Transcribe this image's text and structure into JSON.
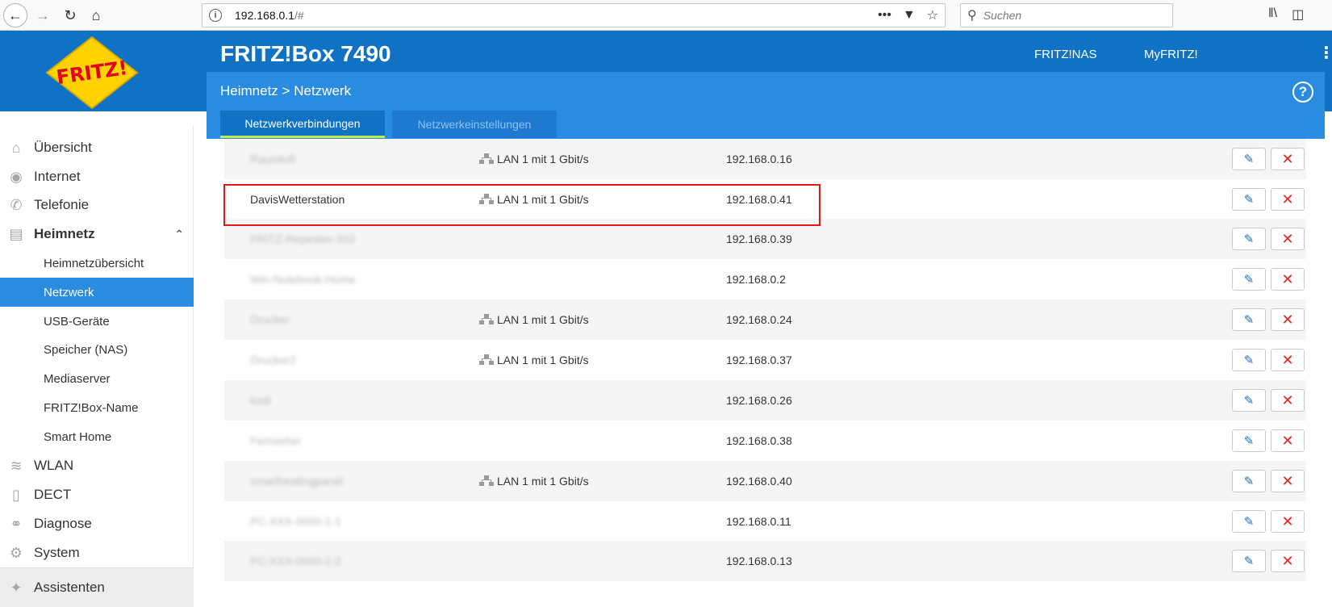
{
  "browser": {
    "url_host": "192.168.0.1",
    "url_rest": "/#",
    "search_placeholder": "Suchen",
    "more_glyph": "•••"
  },
  "header": {
    "logo_text": "FRITZ!",
    "title": "FRITZ!Box 7490",
    "links": [
      "FRITZ!NAS",
      "MyFRITZ!"
    ]
  },
  "breadcrumb": {
    "section": "Heimnetz",
    "separator": ">",
    "page": "Netzwerk"
  },
  "help_glyph": "?",
  "tabs": [
    {
      "label": "Netzwerkverbindungen",
      "active": true
    },
    {
      "label": "Netzwerkeinstellungen",
      "active": false
    }
  ],
  "sidebar": {
    "items": [
      {
        "label": "Übersicht",
        "icon": "home-icon"
      },
      {
        "label": "Internet",
        "icon": "globe-icon"
      },
      {
        "label": "Telefonie",
        "icon": "phone-icon"
      },
      {
        "label": "Heimnetz",
        "icon": "network-icon",
        "expanded": true
      },
      {
        "label": "WLAN",
        "icon": "wifi-icon"
      },
      {
        "label": "DECT",
        "icon": "dect-icon"
      },
      {
        "label": "Diagnose",
        "icon": "diagnose-icon"
      },
      {
        "label": "System",
        "icon": "system-icon"
      },
      {
        "label": "Assistenten",
        "icon": "wizard-icon"
      }
    ],
    "subitems": [
      {
        "label": "Heimnetzübersicht"
      },
      {
        "label": "Netzwerk",
        "active": true
      },
      {
        "label": "USB-Geräte"
      },
      {
        "label": "Speicher (NAS)"
      },
      {
        "label": "Mediaserver"
      },
      {
        "label": "FRITZ!Box-Name"
      },
      {
        "label": "Smart Home"
      }
    ]
  },
  "devices": [
    {
      "name": "Raumluft",
      "blurred": true,
      "connection": "LAN 1 mit 1 Gbit/s",
      "ip": "192.168.0.16"
    },
    {
      "name": "DavisWetterstation",
      "blurred": false,
      "connection": "LAN 1 mit 1 Gbit/s",
      "ip": "192.168.0.41"
    },
    {
      "name": "FRITZ-Repeater-310",
      "blurred": true,
      "connection": "",
      "ip": "192.168.0.39"
    },
    {
      "name": "Win-Notebook-Home",
      "blurred": true,
      "connection": "",
      "ip": "192.168.0.2"
    },
    {
      "name": "Drucker",
      "blurred": true,
      "connection": "LAN 1 mit 1 Gbit/s",
      "ip": "192.168.0.24"
    },
    {
      "name": "Drucker2",
      "blurred": true,
      "connection": "LAN 1 mit 1 Gbit/s",
      "ip": "192.168.0.37"
    },
    {
      "name": "kodi",
      "blurred": true,
      "connection": "",
      "ip": "192.168.0.26"
    },
    {
      "name": "Fernseher",
      "blurred": true,
      "connection": "",
      "ip": "192.168.0.38"
    },
    {
      "name": "smartheatingpanel",
      "blurred": true,
      "connection": "LAN 1 mit 1 Gbit/s",
      "ip": "192.168.0.40"
    },
    {
      "name": "PC-XXX-0000-1-1",
      "blurred": true,
      "connection": "",
      "ip": "192.168.0.11"
    },
    {
      "name": "PC-XXX-0000-1-2",
      "blurred": true,
      "connection": "",
      "ip": "192.168.0.13"
    }
  ],
  "colors": {
    "header_blue": "#0f72c4",
    "subheader_blue": "#2a8ce0",
    "active_tab_underline": "#c6e94a",
    "highlight_red": "#e01818",
    "delete_red": "#e2241a",
    "edit_blue": "#1f6fb8"
  }
}
